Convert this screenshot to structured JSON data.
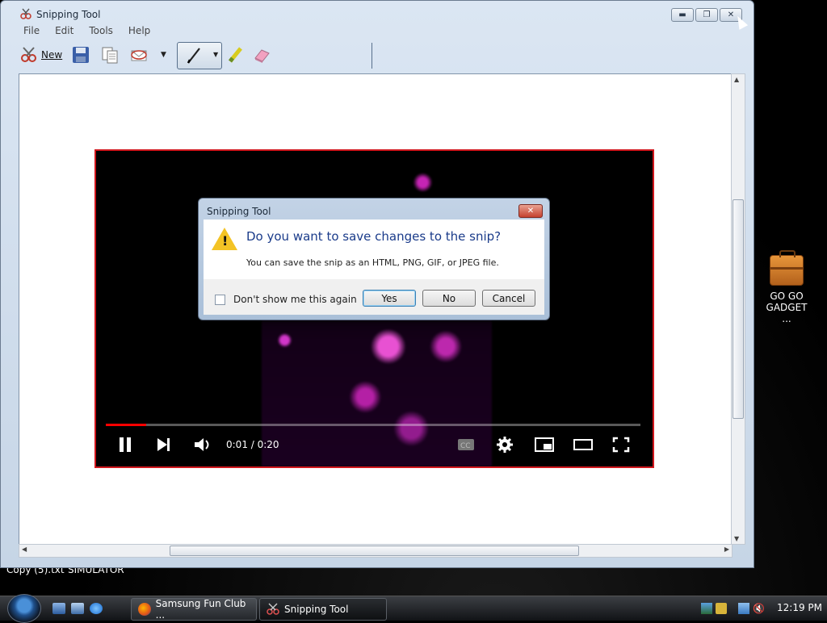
{
  "window": {
    "title": "Snipping Tool",
    "menu": [
      "File",
      "Edit",
      "Tools",
      "Help"
    ],
    "toolbar": {
      "new_label": "New"
    }
  },
  "video": {
    "time": "0:01 / 0:20",
    "progress_fraction": 0.075
  },
  "dialog": {
    "title": "Snipping Tool",
    "heading": "Do you want to save changes to the snip?",
    "text": "You can save the snip as an HTML, PNG, GIF, or JPEG file.",
    "checkbox_label": "Don't show me this again",
    "yes_label": "Yes",
    "no_label": "No",
    "cancel_label": "Cancel"
  },
  "desktop": {
    "gadget_label": "GO GO GADGET ...",
    "behind_labels": [
      "Copy (5).txt",
      "SIMULATOR"
    ]
  },
  "taskbar": {
    "tasks": [
      "Samsung Fun Club ...",
      "Snipping Tool"
    ],
    "clock": "12:19 PM"
  },
  "colors": {
    "snip_border": "#d0161c",
    "progress": "#ff0000",
    "dialog_heading": "#1a3b8a",
    "warning": "#f3c325"
  }
}
